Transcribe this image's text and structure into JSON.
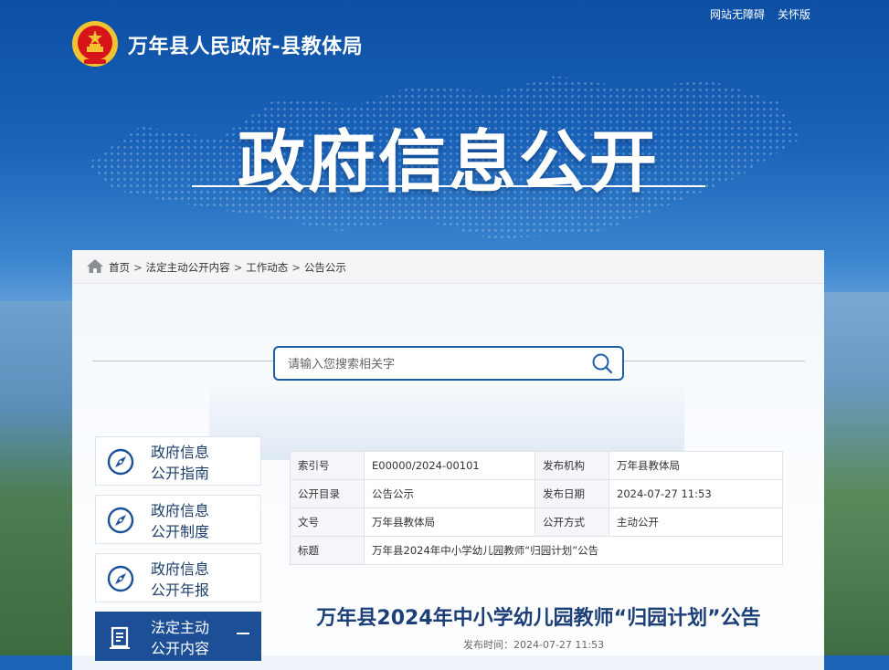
{
  "header": {
    "accessibility_link": "网站无障碍",
    "care_mode_link": "关怀版",
    "site_title": "万年县人民政府-县教体局",
    "banner_title": "政府信息公开"
  },
  "breadcrumb": [
    "首页",
    "法定主动公开内容",
    "工作动态",
    "公告公示"
  ],
  "search": {
    "placeholder": "请输入您搜索相关字"
  },
  "sidebar": {
    "items": [
      {
        "line1": "政府信息",
        "line2": "公开指南",
        "icon": "compass-icon"
      },
      {
        "line1": "政府信息",
        "line2": "公开制度",
        "icon": "compass-icon"
      },
      {
        "line1": "政府信息",
        "line2": "公开年报",
        "icon": "compass-icon"
      },
      {
        "line1": "法定主动",
        "line2": "公开内容",
        "icon": "document-icon",
        "active": true
      }
    ]
  },
  "info_table": {
    "index_label": "索引号",
    "index_value": "E00000/2024-00101",
    "org_label": "发布机构",
    "org_value": "万年县教体局",
    "catalog_label": "公开目录",
    "catalog_value": "公告公示",
    "date_label": "发布日期",
    "date_value": "2024-07-27 11:53",
    "docno_label": "文号",
    "docno_value": "万年县教体局",
    "method_label": "公开方式",
    "method_value": "主动公开",
    "title_label": "标题",
    "title_value": "万年县2024年中小学幼儿园教师“归园计划”公告"
  },
  "article": {
    "title": "万年县2024年中小学幼儿园教师“归园计划”公告",
    "pub_time": "发布时间：2024-07-27 11:53"
  },
  "colors": {
    "primary": "#1c4f96",
    "accent_red": "#d7141a",
    "gold": "#f2c230"
  }
}
